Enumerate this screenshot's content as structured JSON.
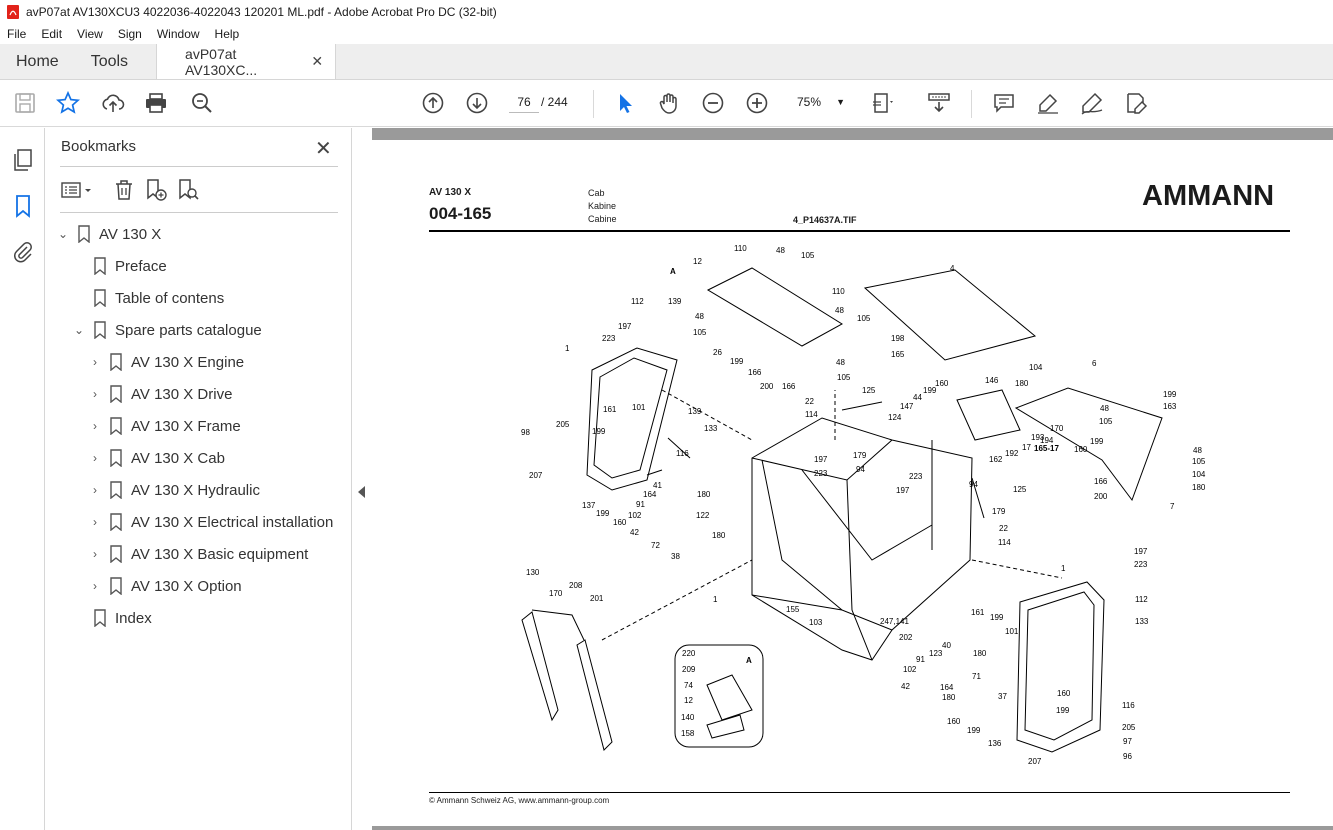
{
  "window": {
    "title": "avP07at AV130XCU3 4022036-4022043 120201 ML.pdf - Adobe Acrobat Pro DC (32-bit)"
  },
  "menu": [
    "File",
    "Edit",
    "View",
    "Sign",
    "Window",
    "Help"
  ],
  "tabs": {
    "home": "Home",
    "tools": "Tools",
    "document": "avP07at AV130XC..."
  },
  "toolbar": {
    "page_current": "76",
    "page_total": "/ 244",
    "zoom": "75%"
  },
  "icons": [
    "save-icon",
    "star-icon",
    "upload-icon",
    "print-icon",
    "zoom-search-icon",
    "page-up-icon",
    "page-down-icon",
    "select-cursor-icon",
    "hand-icon",
    "zoom-out-icon",
    "zoom-in-icon",
    "fit-page-icon",
    "scroll-mode-icon",
    "comment-icon",
    "highlight-icon",
    "sign-icon",
    "fill-sign-icon",
    "pages-panel-icon",
    "bookmark-panel-icon",
    "attachment-icon"
  ],
  "colors": {
    "accent": "#1473e6",
    "gray_bg": "#9a9a9a"
  },
  "bookmarks": {
    "title": "Bookmarks",
    "items": [
      {
        "label": "AV 130 X",
        "level": 0,
        "expanded": true
      },
      {
        "label": "Preface",
        "level": 1
      },
      {
        "label": "Table of contens",
        "level": 1
      },
      {
        "label": "Spare parts catalogue",
        "level": 1,
        "expanded": true
      },
      {
        "label": "AV 130 X Engine",
        "level": 2,
        "collapsed": true
      },
      {
        "label": "AV 130 X Drive",
        "level": 2,
        "collapsed": true
      },
      {
        "label": "AV 130 X Frame",
        "level": 2,
        "collapsed": true
      },
      {
        "label": "AV 130 X Cab",
        "level": 2,
        "collapsed": true
      },
      {
        "label": "AV 130 X Hydraulic",
        "level": 2,
        "collapsed": true
      },
      {
        "label": "AV 130 X Electrical installation",
        "level": 2,
        "collapsed": true
      },
      {
        "label": "AV 130 X Basic equipment",
        "level": 2,
        "collapsed": true
      },
      {
        "label": "AV 130 X Option",
        "level": 2,
        "collapsed": true
      },
      {
        "label": "Index",
        "level": 1
      }
    ]
  },
  "document": {
    "model": "AV 130 X",
    "code": "004-165",
    "lang_en": "Cab",
    "lang_de": "Kabine",
    "lang_fr": "Cabine",
    "file": "4_P14637A.TIF",
    "logo": "AMMANN",
    "footer": "© Ammann Schweiz AG, www.ammann-group.com",
    "detail_label": "A",
    "callouts": [
      "110",
      "48",
      "105",
      "12",
      "A",
      "4",
      "110",
      "48",
      "105",
      "112",
      "139",
      "197",
      "48",
      "223",
      "105",
      "26",
      "199",
      "48",
      "198",
      "165",
      "166",
      "200",
      "166",
      "105",
      "1",
      "104",
      "6",
      "146",
      "125",
      "180",
      "199",
      "163",
      "44",
      "199",
      "160",
      "48",
      "22",
      "114",
      "147",
      "105",
      "161",
      "101",
      "139",
      "124",
      "170",
      "194",
      "98",
      "205",
      "199",
      "133",
      "17",
      "193",
      "165-17",
      "160",
      "199",
      "48",
      "116",
      "179",
      "105",
      "94",
      "197",
      "223",
      "162",
      "192",
      "104",
      "207",
      "223",
      "166",
      "180",
      "41",
      "180",
      "164",
      "94",
      "197",
      "125",
      "200",
      "7",
      "137",
      "91",
      "179",
      "199",
      "102",
      "122",
      "22",
      "160",
      "42",
      "72",
      "38",
      "180",
      "114",
      "1",
      "197",
      "223",
      "130",
      "208",
      "170",
      "201",
      "1",
      "155",
      "112",
      "103",
      "161",
      "199",
      "101",
      "133",
      "247,141",
      "202",
      "220",
      "209",
      "40",
      "74",
      "123",
      "180",
      "91",
      "71",
      "102",
      "37",
      "12",
      "42",
      "164",
      "180",
      "160",
      "140",
      "160",
      "199",
      "116",
      "205",
      "158",
      "136",
      "199",
      "97",
      "207",
      "96"
    ]
  }
}
